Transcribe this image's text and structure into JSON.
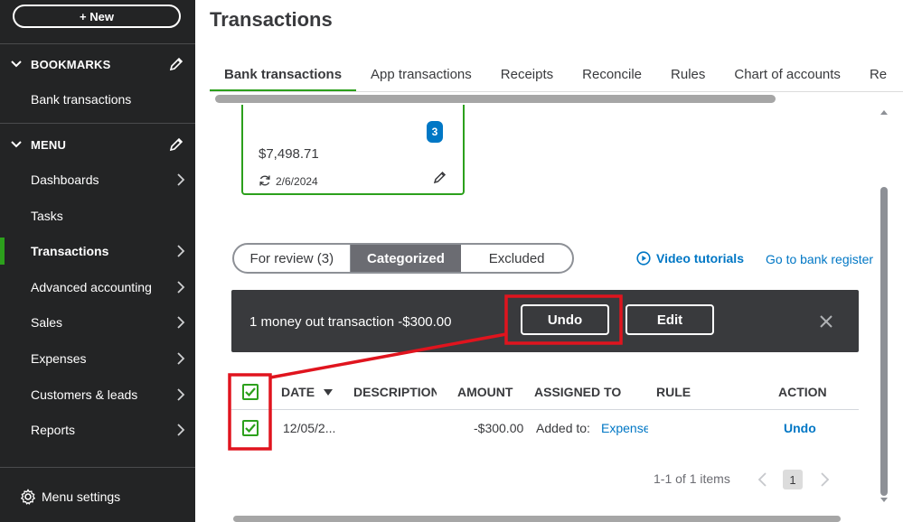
{
  "sidebar": {
    "new_button": "+ New",
    "bookmarks_label": "BOOKMARKS",
    "bookmark_items": [
      "Bank transactions"
    ],
    "menu_label": "MENU",
    "menu_items": [
      {
        "label": "Dashboards",
        "has_arrow": true
      },
      {
        "label": "Tasks",
        "has_arrow": false
      },
      {
        "label": "Transactions",
        "has_arrow": true,
        "active": true
      },
      {
        "label": "Advanced accounting",
        "has_arrow": true
      },
      {
        "label": "Sales",
        "has_arrow": true
      },
      {
        "label": "Expenses",
        "has_arrow": true
      },
      {
        "label": "Customers & leads",
        "has_arrow": true
      },
      {
        "label": "Reports",
        "has_arrow": true
      }
    ],
    "footer_label": "Menu settings"
  },
  "header": {
    "title": "Transactions",
    "tabs": [
      "Bank transactions",
      "App transactions",
      "Receipts",
      "Reconcile",
      "Rules",
      "Chart of accounts",
      "Re"
    ],
    "active_tab": "Bank transactions"
  },
  "account_card": {
    "badge": "3",
    "balance": "$7,498.71",
    "sync_date": "2/6/2024"
  },
  "segment": {
    "for_review": "For review (3)",
    "categorized": "Categorized",
    "excluded": "Excluded",
    "selected": "Categorized"
  },
  "links": {
    "video_tutorials": "Video tutorials",
    "bank_register": "Go to bank register"
  },
  "action_bar": {
    "message": "1 money out transaction -$300.00",
    "undo": "Undo",
    "edit": "Edit"
  },
  "table": {
    "columns": [
      "DATE",
      "DESCRIPTION",
      "AMOUNT",
      "ASSIGNED TO",
      "RULE",
      "ACTION"
    ],
    "rows": [
      {
        "date": "12/05/2...",
        "description": "",
        "amount": "-$300.00",
        "assigned_prefix": "Added to:",
        "assigned_link": "Expense",
        "rule": "",
        "action": "Undo",
        "checked": true
      }
    ],
    "header_checked": true
  },
  "pagination": {
    "summary": "1-1 of 1 items",
    "current_page": "1"
  },
  "colors": {
    "sidebar_bg": "#232425",
    "accent_green": "#2ca01c",
    "link_blue": "#0077c5",
    "action_bar_bg": "#393a3d",
    "annotation_red": "#e0141e"
  }
}
